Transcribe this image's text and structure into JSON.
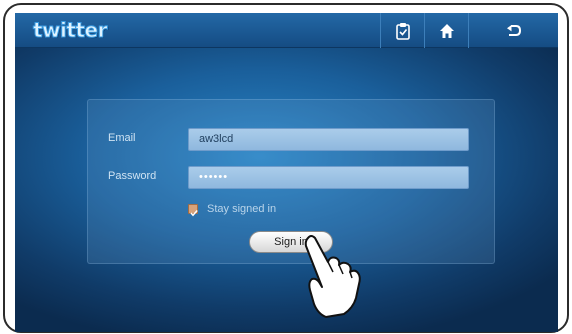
{
  "app": {
    "logo_text": "twitter"
  },
  "toolbar": {
    "icons": [
      "clipboard-icon",
      "home-icon",
      "back-icon"
    ]
  },
  "login": {
    "email_label": "Email",
    "email_value": "aw3lcd",
    "password_label": "Password",
    "password_value": "••••••",
    "stay_signed_in_label": "Stay signed in",
    "stay_signed_in_checked": true,
    "sign_in_label": "Sign in"
  },
  "colors": {
    "background": "#1a5f9b",
    "topbar": "#1a5a96",
    "field": "#9fc4e6",
    "checkbox": "#d7a27a"
  }
}
